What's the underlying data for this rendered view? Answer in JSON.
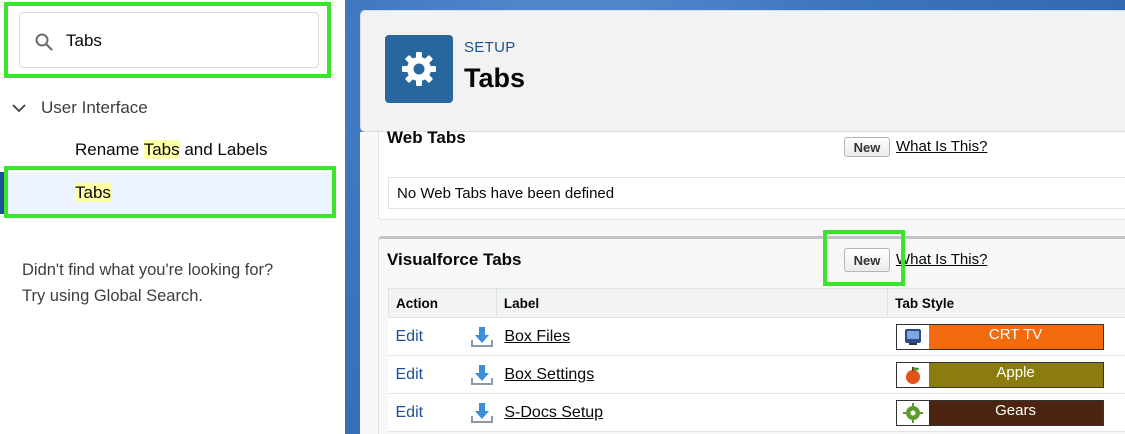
{
  "sidebar": {
    "search": {
      "value": "Tabs"
    },
    "tree": {
      "node_label": "User Interface",
      "items": [
        {
          "prefix": "Rename ",
          "match": "Tabs",
          "suffix": " and Labels"
        },
        {
          "prefix": "",
          "match": "Tabs",
          "suffix": ""
        }
      ]
    },
    "not_found": {
      "line1": "Didn't find what you're looking for?",
      "line2": "Try using Global Search."
    }
  },
  "header": {
    "breadcrumb": "SETUP",
    "title": "Tabs"
  },
  "web_tabs": {
    "title": "Web Tabs",
    "new_label": "New",
    "what_is_this": "What Is This?",
    "empty_message": "No Web Tabs have been defined"
  },
  "vf_tabs": {
    "title": "Visualforce Tabs",
    "new_label": "New",
    "what_is_this": "What Is This?",
    "columns": [
      "Action",
      "Label",
      "Tab Style"
    ],
    "rows": [
      {
        "action": "Edit",
        "label": "Box Files",
        "style_name": "CRT TV",
        "style_color": "#f26b0f",
        "style_icon": "tv-icon"
      },
      {
        "action": "Edit",
        "label": "Box Settings",
        "style_name": "Apple",
        "style_color": "#8a7d0e",
        "style_icon": "apple-icon"
      },
      {
        "action": "Edit",
        "label": "S-Docs Setup",
        "style_name": "Gears",
        "style_color": "#4d2410",
        "style_icon": "gears-icon"
      }
    ]
  },
  "colors": {
    "highlight_border": "#3ae52a",
    "accent_blue": "#1b5297",
    "gear_tile": "#28679d"
  }
}
